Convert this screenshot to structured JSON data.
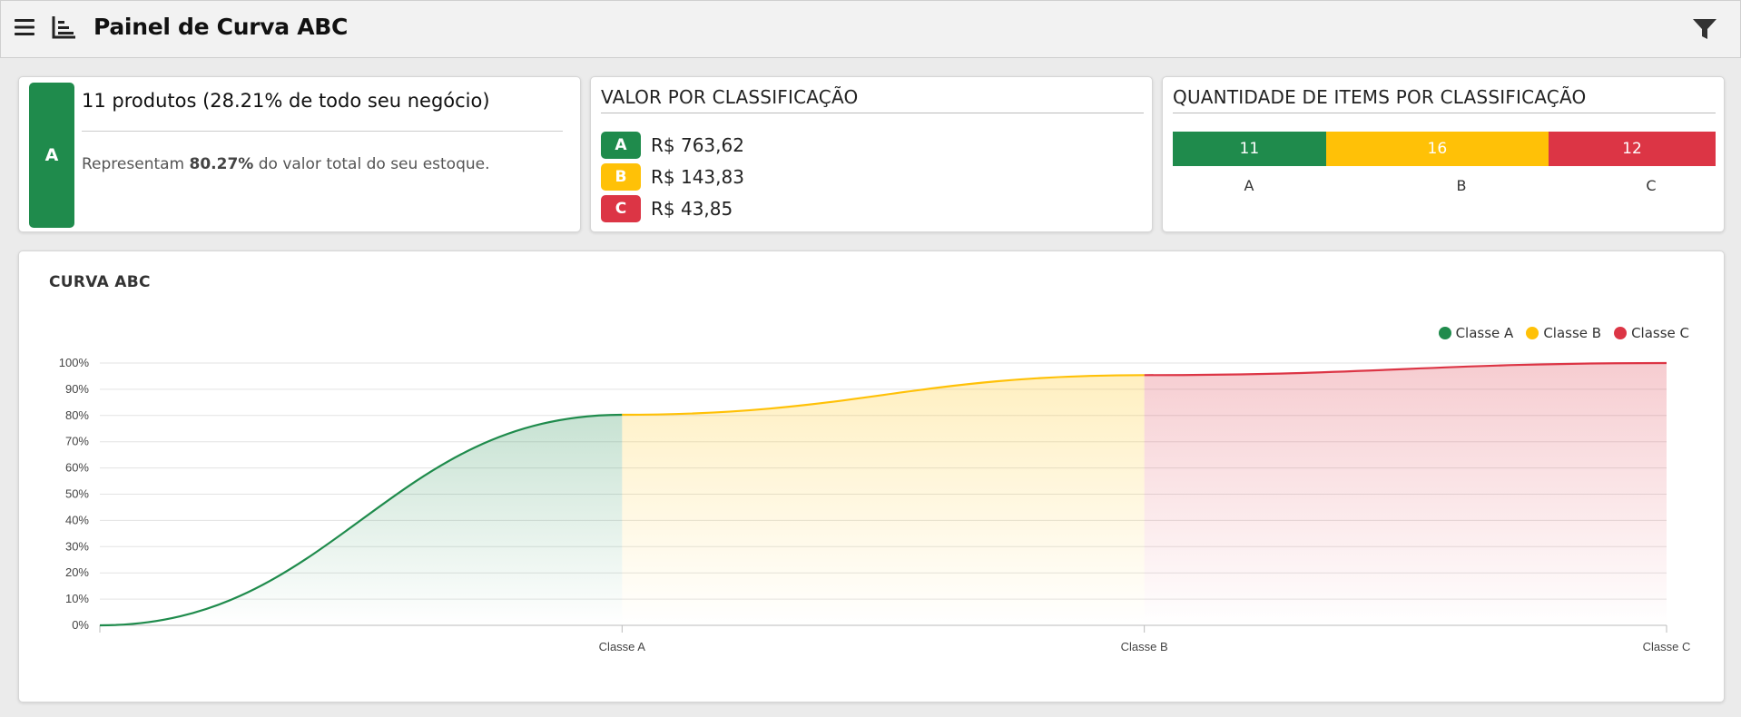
{
  "header": {
    "title": "Painel de Curva ABC",
    "menu_icon": "hamburger-menu-icon",
    "chart_icon": "bar-chart-icon",
    "filter_icon": "filter-icon"
  },
  "summary_card": {
    "class_letter": "A",
    "title": "11 produtos (28.21% de todo seu negócio)",
    "desc_prefix": "Representam ",
    "desc_highlight": "80.27%",
    "desc_suffix": " do valor total do seu estoque.",
    "color": "#1f8b4c"
  },
  "valor_card": {
    "title": "VALOR POR CLASSIFICAÇÃO",
    "rows": [
      {
        "letter": "A",
        "value": "R$ 763,62",
        "color": "#1f8b4c"
      },
      {
        "letter": "B",
        "value": "R$ 143,83",
        "color": "#ffc107"
      },
      {
        "letter": "C",
        "value": "R$ 43,85",
        "color": "#dc3545"
      }
    ]
  },
  "qtd_card": {
    "title": "QUANTIDADE DE ITEMS POR CLASSIFICAÇÃO",
    "segments": [
      {
        "label": "A",
        "count": "11",
        "color": "#1f8b4c"
      },
      {
        "label": "B",
        "count": "16",
        "color": "#ffc107"
      },
      {
        "label": "C",
        "count": "12",
        "color": "#dc3545"
      }
    ]
  },
  "chart_card": {
    "title": "CURVA ABC"
  },
  "chart_data": {
    "type": "area",
    "title": "CURVA ABC",
    "x_categories": [
      "",
      "Classe A",
      "Classe B",
      "Classe C"
    ],
    "ylim": [
      0,
      100
    ],
    "y_ticks": [
      "0%",
      "10%",
      "20%",
      "30%",
      "40%",
      "50%",
      "60%",
      "70%",
      "80%",
      "90%",
      "100%"
    ],
    "grid": true,
    "legend_position": "top-right",
    "series": [
      {
        "name": "Classe A",
        "color": "#1f8b4c",
        "points": [
          [
            0,
            0
          ],
          [
            1,
            80.27
          ]
        ]
      },
      {
        "name": "Classe B",
        "color": "#ffc107",
        "points": [
          [
            1,
            80.27
          ],
          [
            2,
            95.4
          ]
        ]
      },
      {
        "name": "Classe C",
        "color": "#dc3545",
        "points": [
          [
            2,
            95.4
          ],
          [
            3,
            100
          ]
        ]
      }
    ]
  }
}
